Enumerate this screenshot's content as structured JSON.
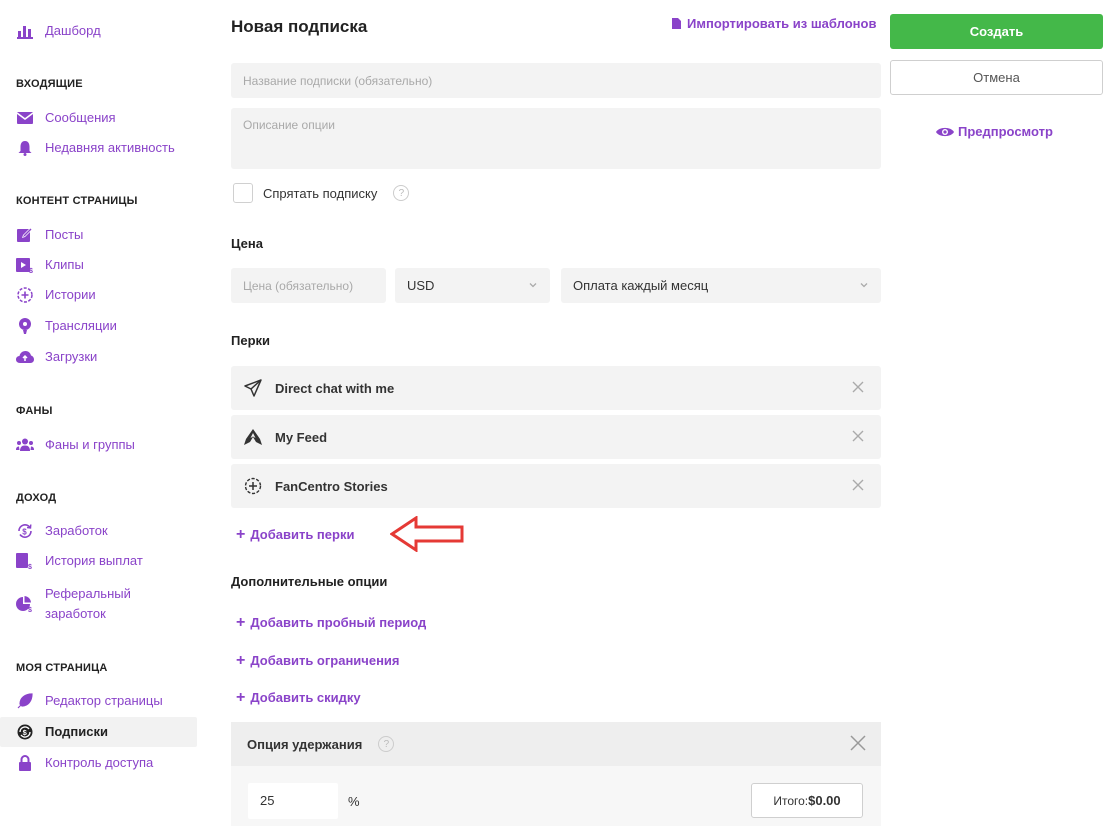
{
  "sidebar": {
    "dashboard": "Дашборд",
    "sections": {
      "inbox": "ВХОДЯЩИЕ",
      "content": "КОНТЕНТ СТРАНИЦЫ",
      "fans": "ФАНЫ",
      "income": "ДОХОД",
      "mypage": "МОЯ СТРАНИЦА"
    },
    "items": {
      "messages": "Сообщения",
      "activity": "Недавняя активность",
      "posts": "Посты",
      "clips": "Клипы",
      "stories": "Истории",
      "streams": "Трансляции",
      "uploads": "Загрузки",
      "fans_groups": "Фаны и группы",
      "earnings": "Заработок",
      "payout_history": "История выплат",
      "referral_1": "Реферальный",
      "referral_2": "заработок",
      "page_editor": "Редактор страницы",
      "subscriptions": "Подписки",
      "access_control": "Контроль доступа"
    }
  },
  "main": {
    "title": "Новая подписка",
    "import_link": "Импортировать из шаблонов",
    "name_placeholder": "Название подписки (обязательно)",
    "desc_placeholder": "Описание опции",
    "hide_label": "Спрятать подписку",
    "price_section": "Цена",
    "price_placeholder": "Цена (обязательно)",
    "currency": "USD",
    "billing": "Оплата каждый месяц",
    "perks_section": "Перки",
    "perks": [
      {
        "label": "Direct chat with me",
        "icon": "send-icon"
      },
      {
        "label": "My Feed",
        "icon": "feed-icon"
      },
      {
        "label": "FanCentro Stories",
        "icon": "stories-icon"
      }
    ],
    "add_perks": "Добавить перки",
    "extra_section": "Дополнительные опции",
    "add_trial": "Добавить пробный период",
    "add_limits": "Добавить ограничения",
    "add_discount": "Добавить скидку",
    "retention_label": "Опция удержания",
    "retention_value": "25",
    "percent_sign": "%",
    "total_label": "Итого:",
    "total_value": "$0.00"
  },
  "actions": {
    "create": "Создать",
    "cancel": "Отмена",
    "preview": "Предпросмотр"
  },
  "colors": {
    "accent": "#8a43c9",
    "create_button": "#44b849",
    "annotation_arrow": "#e53935"
  }
}
